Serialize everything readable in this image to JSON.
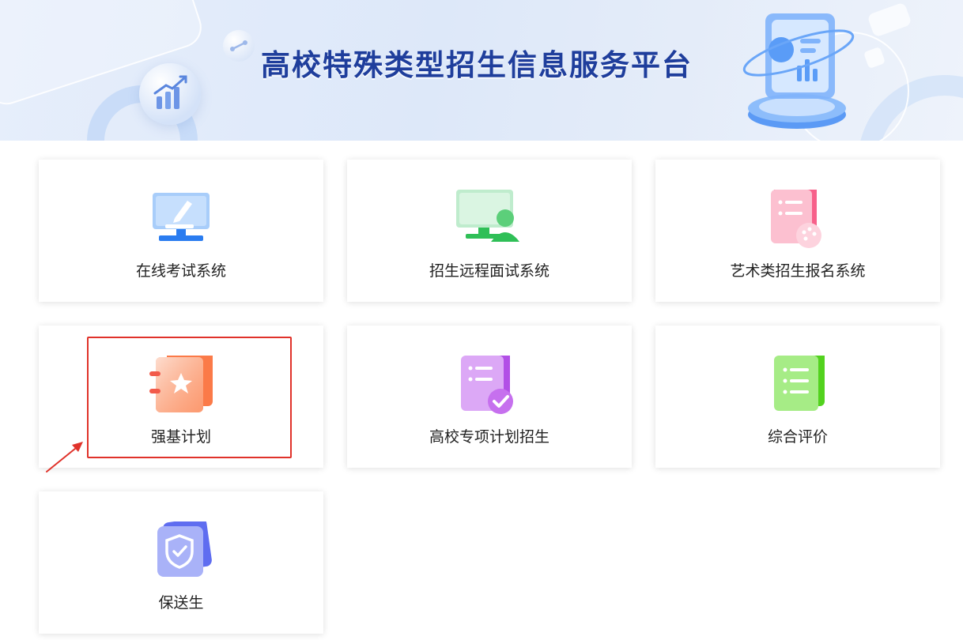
{
  "banner": {
    "title": "高校特殊类型招生信息服务平台"
  },
  "cards": [
    {
      "label": "在线考试系统",
      "icon": "monitor-pen-icon",
      "color": "#3b8df0"
    },
    {
      "label": "招生远程面试系统",
      "icon": "monitor-user-icon",
      "color": "#2fbf57"
    },
    {
      "label": "艺术类招生报名系统",
      "icon": "document-palette-icon",
      "color": "#f2567e"
    },
    {
      "label": "强基计划",
      "icon": "notebook-star-icon",
      "color": "#fb6a3c"
    },
    {
      "label": "高校专项计划招生",
      "icon": "document-check-icon",
      "color": "#b24fe6"
    },
    {
      "label": "综合评价",
      "icon": "document-list-icon",
      "color": "#4ccf1c"
    },
    {
      "label": "保送生",
      "icon": "shield-check-icon",
      "color": "#5f6df0"
    }
  ],
  "annotation": {
    "highlight_color": "#e0322a"
  }
}
